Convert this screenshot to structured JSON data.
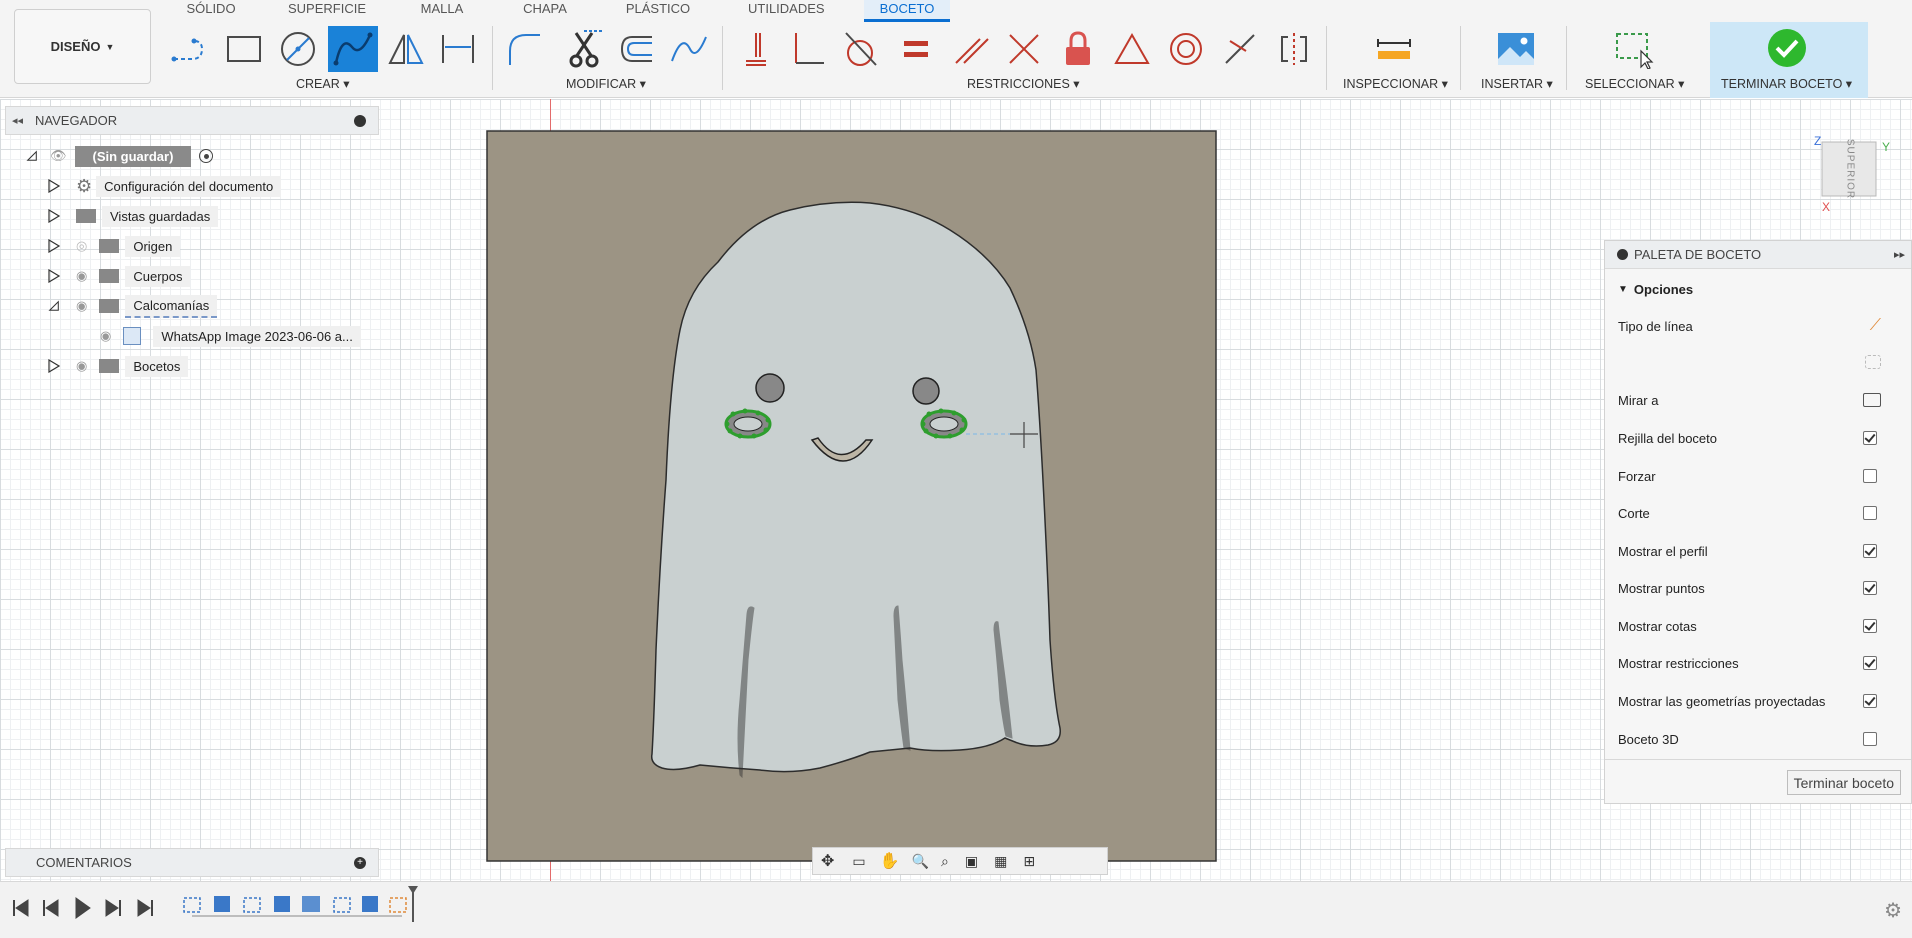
{
  "workspace": {
    "label": "DISEÑO"
  },
  "tabs": [
    {
      "label": "SÓLIDO"
    },
    {
      "label": "SUPERFICIE"
    },
    {
      "label": "MALLA"
    },
    {
      "label": "CHAPA"
    },
    {
      "label": "PLÁSTICO"
    },
    {
      "label": "UTILIDADES"
    },
    {
      "label": "BOCETO"
    }
  ],
  "groups": {
    "crear": "CREAR",
    "modificar": "MODIFICAR",
    "restricciones": "RESTRICCIONES",
    "inspeccionar": "INSPECCIONAR",
    "insertar": "INSERTAR",
    "seleccionar": "SELECCIONAR",
    "terminar": "TERMINAR BOCETO"
  },
  "browser": {
    "title": "NAVEGADOR",
    "root": "(Sin guardar)",
    "items": [
      {
        "label": "Configuración del documento"
      },
      {
        "label": "Vistas guardadas"
      },
      {
        "label": "Origen"
      },
      {
        "label": "Cuerpos"
      },
      {
        "label": "Calcomanías"
      },
      {
        "label": "WhatsApp Image 2023-06-06 a..."
      },
      {
        "label": "Bocetos"
      }
    ]
  },
  "comments": {
    "title": "COMENTARIOS"
  },
  "viewcube": {
    "face": "SUPERIOR",
    "axis_z": "Z",
    "axis_y": "Y",
    "axis_x": "X"
  },
  "palette": {
    "title": "PALETA DE BOCETO",
    "section": "Opciones",
    "rows": [
      {
        "label": "Tipo de línea"
      },
      {
        "label": ""
      },
      {
        "label": "Mirar a"
      },
      {
        "label": "Rejilla del boceto",
        "checked": true
      },
      {
        "label": "Forzar",
        "checked": false
      },
      {
        "label": "Corte",
        "checked": false
      },
      {
        "label": "Mostrar el perfil",
        "checked": true
      },
      {
        "label": "Mostrar puntos",
        "checked": true
      },
      {
        "label": "Mostrar cotas",
        "checked": true
      },
      {
        "label": "Mostrar restricciones",
        "checked": true
      },
      {
        "label": "Mostrar las geometrías proyectadas",
        "checked": true
      },
      {
        "label": "Boceto 3D",
        "checked": false
      }
    ],
    "finish_button": "Terminar boceto"
  },
  "colors": {
    "accent": "#0a6ed1",
    "finish_bg": "#cde7f7",
    "decal_bg": "#9c9484",
    "ghost": "#c9d0d0"
  }
}
